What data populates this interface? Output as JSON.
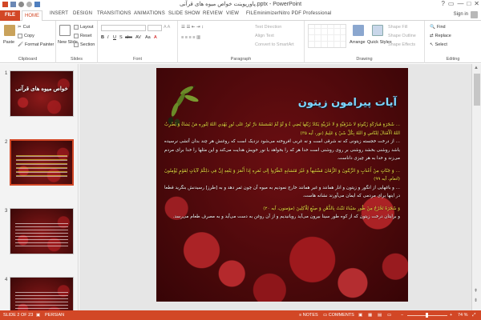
{
  "window": {
    "title": "پاورپوینت خواص میوه های قرآنی.pptx - PowerPoint",
    "controls": [
      "?",
      "▭",
      "—",
      "□",
      "✕"
    ]
  },
  "tabs": {
    "file": "FILE",
    "home": "HOME",
    "items": [
      "INSERT",
      "DESIGN",
      "TRANSITIONS",
      "ANIMATIONS",
      "SLIDE SHOW",
      "REVIEW",
      "VIEW",
      "FILEminimizer",
      "Nitro PDF Professional"
    ],
    "signin": "Sign in"
  },
  "ribbon": {
    "clipboard": {
      "label": "Clipboard",
      "paste": "Paste",
      "cut": "Cut",
      "copy": "Copy",
      "format_painter": "Format Painter"
    },
    "slides": {
      "label": "Slides",
      "new_slide": "New Slide",
      "layout": "Layout",
      "reset": "Reset",
      "section": "Section"
    },
    "font": {
      "label": "Font",
      "buttons": [
        "B",
        "I",
        "U",
        "S",
        "abc",
        "AV",
        "Aa",
        "A"
      ]
    },
    "paragraph": {
      "label": "Paragraph",
      "text_direction": "Text Direction",
      "align_text": "Align Text",
      "convert_smartart": "Convert to SmartArt"
    },
    "drawing": {
      "label": "Drawing",
      "arrange": "Arrange",
      "quick_styles": "Quick Styles",
      "shape_fill": "Shape Fill",
      "shape_outline": "Shape Outline",
      "shape_effects": "Shape Effects"
    },
    "editing": {
      "label": "Editing",
      "find": "Find",
      "replace": "Replace",
      "select": "Select"
    }
  },
  "thumbnails": [
    {
      "num": "1",
      "title": "خواص میوه های قرآنی"
    },
    {
      "num": "2",
      "title": ""
    },
    {
      "num": "3",
      "title": ""
    },
    {
      "num": "4",
      "title": ""
    }
  ],
  "slide": {
    "title": "آیات پیرامون زیتون",
    "paragraphs": [
      {
        "ayah": "... شَجَرَةٍ مُبارَكَةٍ زَيْتُونَةٍ لا شَرْقِيَّةٍ وَ لا غَرْبِيَّةٍ يَكادُ زَيْتُها يُضِي ءُ وَ لَوْ لَمْ تَمْسَسْهُ نارٌ نُورٌ عَلى نُورٍ يَهْدِي اللهُ لِنُورِهِ مَنْ يَشاءُ وَ يَضْرِبُ اللهُ الْأَمْثالَ لِلنّاسِ وَ اللهُ بِكُلِّ شَيْ ءٍ عَلِيمٌ (نور، آیه ۳۵)",
        "trans": "... از درخت خجسته زیتونی که نه شرقی است و نه غربی افروخته می‌شود نزدیک است که روغنش هر چند بدان آتشی نرسیده باشد روشنی بخشد روشنی بر روی روشنی است خدا هر که را بخواهد با نور خویش هدایت می‌کند و این مثلها را خدا برای مردم می‌زند و خدا به هر چیزی داناست."
      },
      {
        "ayah": "... وَ جَنّاتٍ مِنْ أَعْنابٍ وَ الزَّيْتُونَ وَ الرُّمّانَ مُشْتَبِهاً وَ غَيْرَ مُتَشابِهٍ انْظُرُوا إِلى ثَمَرِهِ إِذا أَثْمَرَ وَ يَنْعِهِ إِنَّ فِي ذلِكُمْ لَآياتٍ لِقَوْمٍ يُؤْمِنُونَ (انعام، آیه ۹۹)",
        "trans": "... و باغهایی از انگور و زیتون و انار همانند و غیر همانند خارج نمودیم به میوه آن چون ثمر دهد و به [طرز] رسیدنش بنگرید قطعا در اینها برای مردمی که ایمان می‌آورند نشانه هاست."
      },
      {
        "ayah": "وَ شَجَرَةً تَخْرُجُ مِنْ طُورِ سَيْناءَ تَنْبُتُ بِالدُّهْنِ وَ صِبْغٍ لِلْآكِلِينَ (مؤمنون، آیه ۲۰)",
        "trans": "و برایتان درخت زیتون که از کوه طور سینا بیرون می‌آید رویانیدیم و از آن روغن به دست می‌آید و به مصرف طعام می‌رسد."
      }
    ]
  },
  "statusbar": {
    "slide_of": "SLIDE 2 OF 23",
    "language": "PERSIAN",
    "notes": "NOTES",
    "comments": "COMMENTS",
    "zoom": "74 %"
  },
  "colors": {
    "accent": "#d24726",
    "title_blue": "#7dd6ff",
    "ayah_yellow": "#f2e545"
  }
}
